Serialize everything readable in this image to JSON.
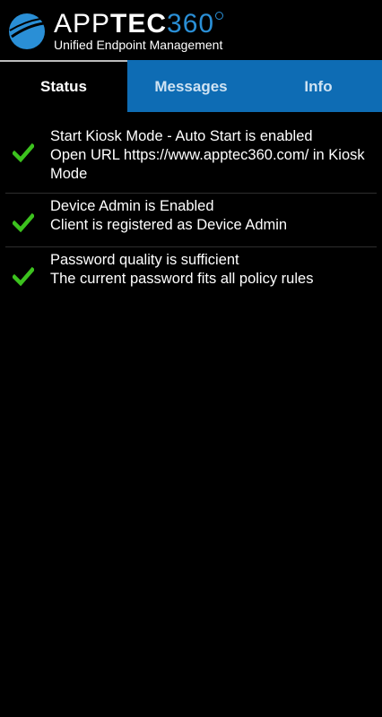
{
  "header": {
    "brand_prefix": "APP",
    "brand_bold": "TEC",
    "brand_suffix": "360",
    "tagline": "Unified Endpoint Management"
  },
  "tabs": [
    {
      "label": "Status",
      "active": true
    },
    {
      "label": "Messages",
      "active": false
    },
    {
      "label": "Info",
      "active": false
    }
  ],
  "status_items": [
    {
      "title": "Start Kiosk Mode - Auto Start is enabled",
      "detail": "Open URL https://www.apptec360.com/ in Kiosk Mode"
    },
    {
      "title": "Device Admin is Enabled",
      "detail": "Client is registered as Device Admin"
    },
    {
      "title": "Password quality is sufficient",
      "detail": "The current password fits all policy rules"
    }
  ],
  "colors": {
    "accent": "#0e6cb4",
    "check": "#3cc21e",
    "background": "#000000"
  },
  "icons": {
    "status_ok": "checkmark-icon",
    "logo": "apptec-logo-icon"
  }
}
